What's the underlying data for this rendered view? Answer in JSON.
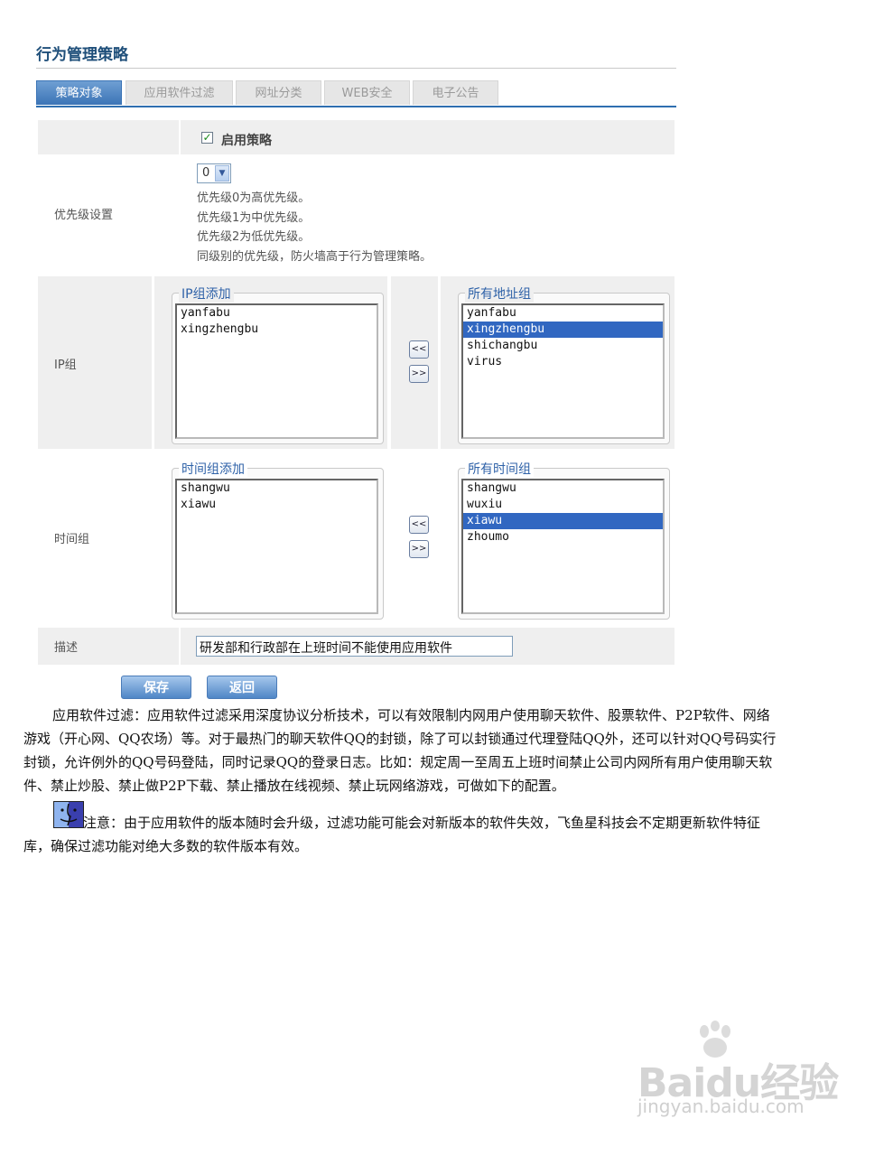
{
  "page": {
    "title": "行为管理策略"
  },
  "tabs": [
    {
      "label": "策略对象",
      "active": true
    },
    {
      "label": "应用软件过滤",
      "active": false
    },
    {
      "label": "网址分类",
      "active": false
    },
    {
      "label": "WEB安全",
      "active": false
    },
    {
      "label": "电子公告",
      "active": false
    }
  ],
  "enable": {
    "label": "启用策略",
    "checked": true,
    "mark": "✓"
  },
  "priority": {
    "label": "优先级设置",
    "value": "0",
    "hints": [
      "优先级0为高优先级。",
      "优先级1为中优先级。",
      "优先级2为低优先级。",
      "同级别的优先级，防火墙高于行为管理策略。"
    ]
  },
  "ip_group": {
    "label": "IP组",
    "added_legend": "IP组添加",
    "added": [
      "yanfabu",
      "xingzhengbu"
    ],
    "all_legend": "所有地址组",
    "all": [
      "yanfabu",
      "xingzhengbu",
      "shichangbu",
      "virus"
    ],
    "all_selected_index": 1
  },
  "time_group": {
    "label": "时间组",
    "added_legend": "时间组添加",
    "added": [
      "shangwu",
      "xiawu"
    ],
    "all_legend": "所有时间组",
    "all": [
      "shangwu",
      "wuxiu",
      "xiawu",
      "zhoumo"
    ],
    "all_selected_index": 2
  },
  "move_buttons": {
    "left": "<<",
    "right": ">>"
  },
  "description": {
    "label": "描述",
    "value": "研发部和行政部在上班时间不能使用应用软件"
  },
  "buttons": {
    "save": "保存",
    "back": "返回"
  },
  "article": {
    "para1_line1": "应用软件过滤：应用软件过滤采用深度协议分析技术，可以有效限制内网用户使用聊天软件、股票软件、P2P软件、网络",
    "para1_line2": "游戏（开心网、QQ农场）等。对于最热门的聊天软件QQ的封锁，除了可以封锁通过代理登陆QQ外，还可以针对QQ号码实行",
    "para1_line3": "封锁，允许例外的QQ号码登陆，同时记录QQ的登录日志。比如：规定周一至周五上班时间禁止公司内网所有用户使用聊天软",
    "para1_line4": "件、禁止炒股、禁止做P2P下载、禁止播放在线视频、禁止玩网络游戏，可做如下的配置。",
    "note_line1": "注意：由于应用软件的版本随时会升级，过滤功能可能会对新版本的软件失效，飞鱼星科技会不定期更新软件特征",
    "note_line2": "库，确保过滤功能对绝大多数的软件版本有效。"
  },
  "watermark": {
    "logo": "Baidu经验",
    "url": "jingyan.baidu.com"
  }
}
